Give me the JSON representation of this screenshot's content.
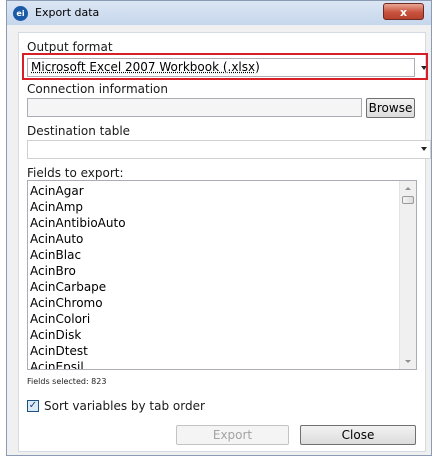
{
  "window": {
    "title": "Export data",
    "app_icon": "ei",
    "close_glyph": "x"
  },
  "output_format": {
    "label": "Output format",
    "selected": "Microsoft Excel 2007 Workbook (.xlsx)"
  },
  "connection": {
    "label": "Connection information",
    "value": "",
    "browse_label": "Browse"
  },
  "destination": {
    "label": "Destination table",
    "selected": ""
  },
  "fields": {
    "label": "Fields to export:",
    "items": [
      "AcinAgar",
      "AcinAmp",
      "AcinAntibioAuto",
      "AcinAuto",
      "AcinBlac",
      "AcinBro",
      "AcinCarbape",
      "AcinChromo",
      "AcinColori",
      "AcinDisk",
      "AcinDtest",
      "AcinEpsil"
    ],
    "selected_count": "Fields selected: 823"
  },
  "sort": {
    "label": "Sort variables by tab order",
    "checked": true,
    "check_glyph": "✓"
  },
  "buttons": {
    "export_label": "Export",
    "close_label": "Close"
  },
  "colors": {
    "highlight": "#d61f26",
    "close_button": "#c8533e"
  }
}
